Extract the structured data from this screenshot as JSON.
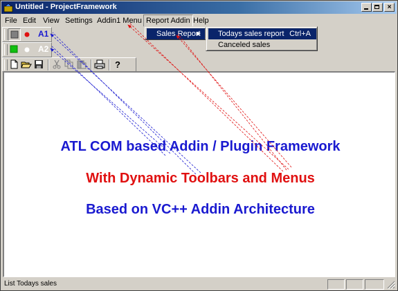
{
  "window": {
    "title": "Untitled - ProjectFramework"
  },
  "menubar": {
    "items": [
      {
        "label": "File"
      },
      {
        "label": "Edit"
      },
      {
        "label": "View"
      },
      {
        "label": "Settings"
      },
      {
        "label": "Addin1 Menu"
      },
      {
        "label": "Report Addin"
      },
      {
        "label": "Help"
      }
    ]
  },
  "toolbar_a1": {
    "label": "A1"
  },
  "toolbar_a2": {
    "label": "A2"
  },
  "menu_report": {
    "items": [
      {
        "label": "Sales Report"
      }
    ]
  },
  "menu_sales": {
    "items": [
      {
        "label": "Todays sales report",
        "shortcut": "Ctrl+A"
      },
      {
        "label": "Canceled sales"
      }
    ]
  },
  "content": {
    "line1": "ATL COM based Addin / Plugin Framework",
    "line2": "With Dynamic Toolbars and Menus",
    "line3": "Based on VC++ Addin Architecture"
  },
  "status": {
    "text": "List Todays sales"
  },
  "colors": {
    "blue_text": "#1a1ad0",
    "red_text": "#e01010",
    "highlight": "#0a246a"
  }
}
